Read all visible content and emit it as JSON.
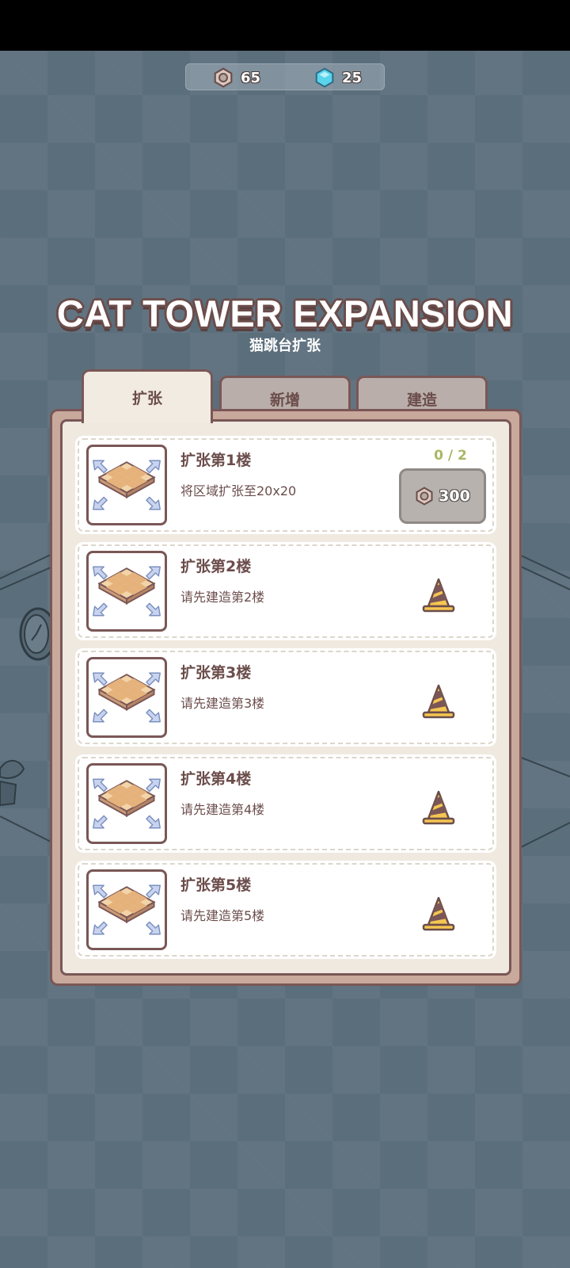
{
  "currencies": {
    "nuts": {
      "value": "65",
      "icon": "hex-nut-icon"
    },
    "gems": {
      "value": "25",
      "icon": "gem-icon"
    }
  },
  "header": {
    "title": "CAT TOWER EXPANSION",
    "subtitle": "猫跳台扩张"
  },
  "tabs": [
    {
      "label": "扩张",
      "active": true
    },
    {
      "label": "新增",
      "active": false
    },
    {
      "label": "建造",
      "active": false
    }
  ],
  "items": [
    {
      "title": "扩张第1楼",
      "desc": "将区域扩张至20x20",
      "progress": "0 / 2",
      "cost": "300",
      "state": "available"
    },
    {
      "title": "扩张第2楼",
      "desc": "请先建造第2楼",
      "state": "locked",
      "icon": "traffic-cone-icon"
    },
    {
      "title": "扩张第3楼",
      "desc": "请先建造第3楼",
      "state": "locked",
      "icon": "traffic-cone-icon"
    },
    {
      "title": "扩张第4楼",
      "desc": "请先建造第4楼",
      "state": "locked",
      "icon": "traffic-cone-icon"
    },
    {
      "title": "扩张第5楼",
      "desc": "请先建造第5楼",
      "state": "locked",
      "icon": "traffic-cone-icon"
    }
  ],
  "colors": {
    "background": "#5b6e7b",
    "panel_border": "#7a5756",
    "text_brown": "#6b4d4b",
    "progress_green": "#a9b764"
  }
}
